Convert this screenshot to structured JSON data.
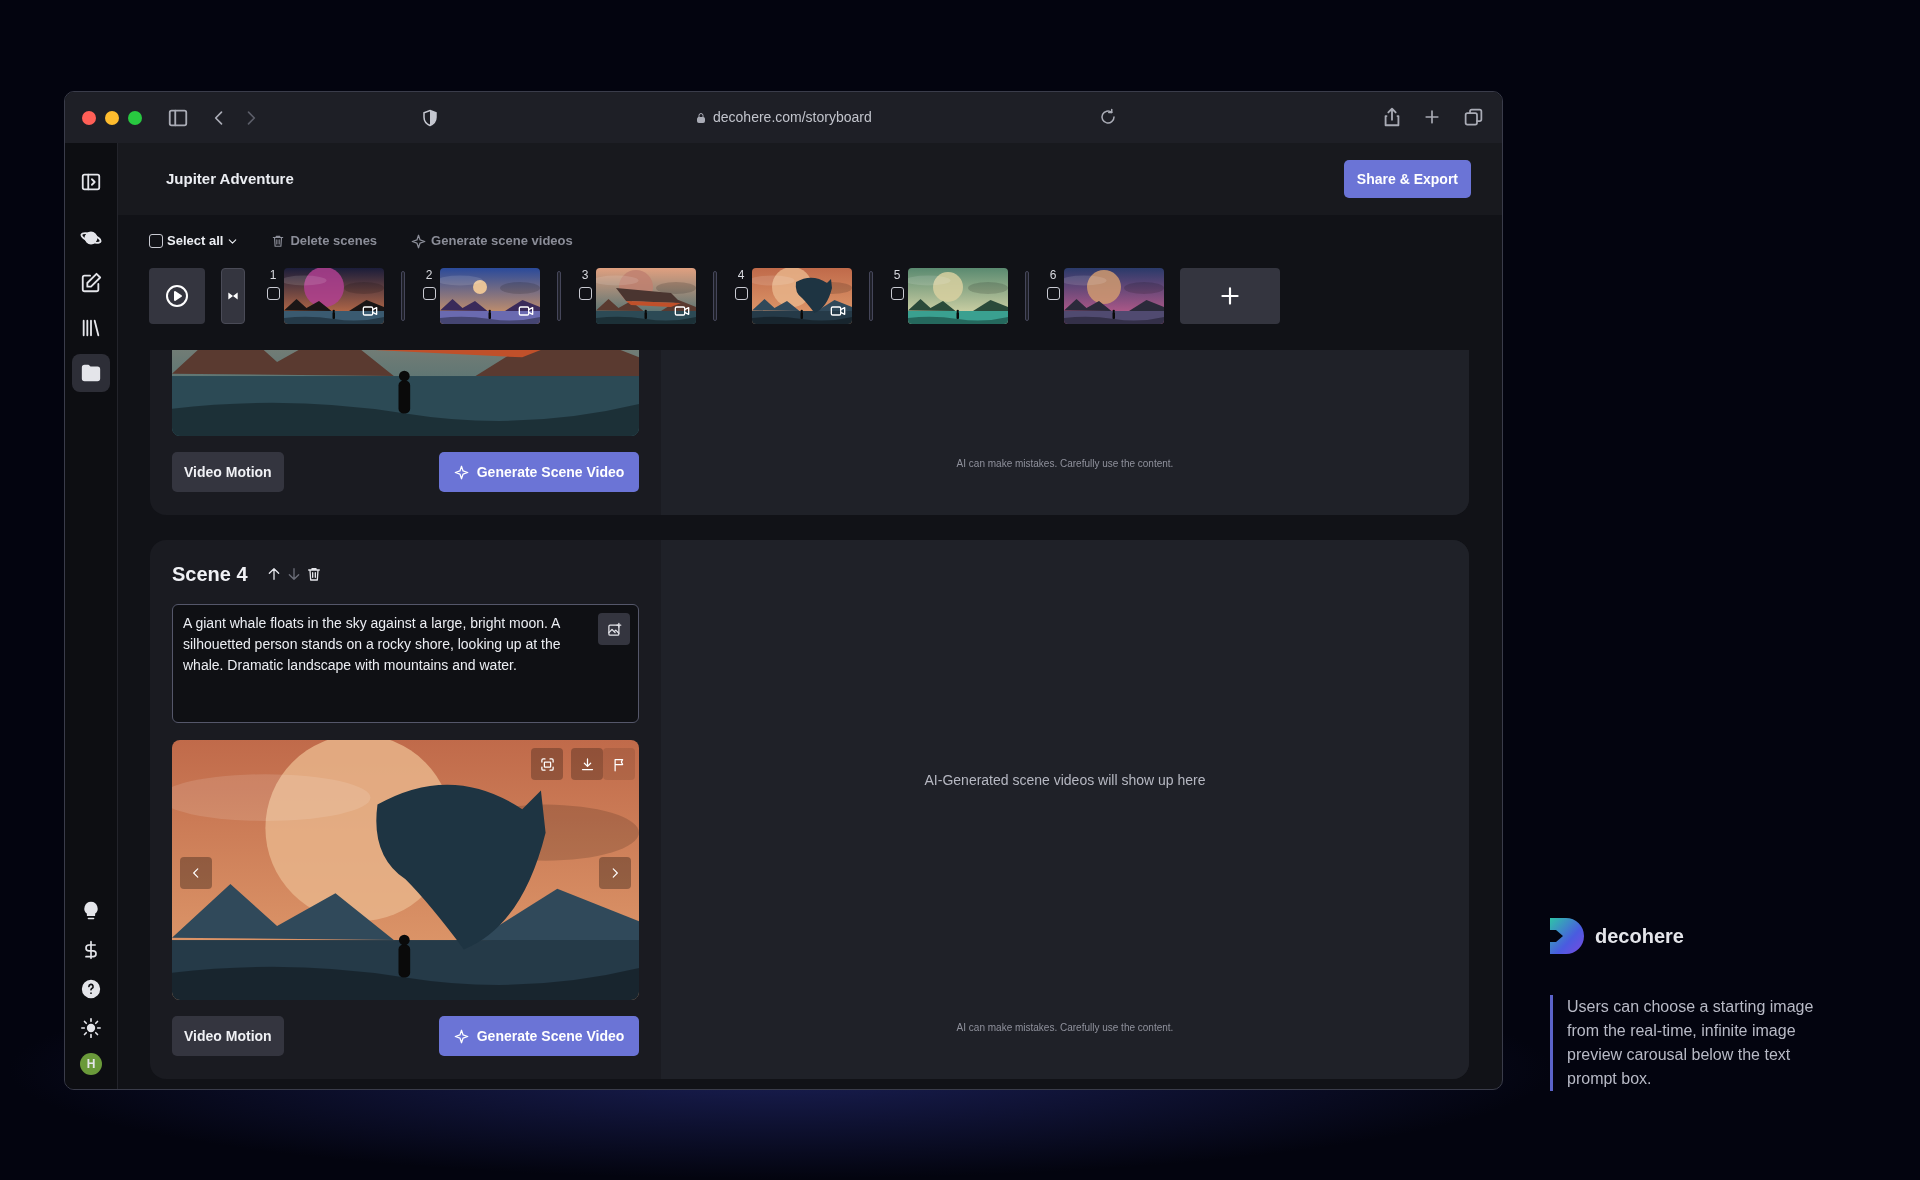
{
  "browser": {
    "url": "decohere.com/storyboard"
  },
  "sidebar": {
    "top_items": [
      {
        "selected": false
      },
      {
        "selected": false
      },
      {
        "selected": false
      },
      {
        "selected": false
      },
      {
        "selected": true
      }
    ],
    "bottom_items": [
      {
        "selected": false
      },
      {
        "selected": false
      },
      {
        "selected": false
      },
      {
        "selected": false
      }
    ],
    "avatar": "H"
  },
  "header": {
    "title": "Jupiter Adventure",
    "share_button": "Share & Export"
  },
  "toolbar": {
    "select_all": "Select all",
    "select_all_checked": false,
    "delete": "Delete scenes",
    "generate": "Generate scene videos"
  },
  "strip": [
    {
      "number": "1",
      "checked": false,
      "has_video": true
    },
    {
      "number": "2",
      "checked": false,
      "has_video": true
    },
    {
      "number": "3",
      "checked": false,
      "has_video": true
    },
    {
      "number": "4",
      "checked": false,
      "has_video": true
    },
    {
      "number": "5",
      "checked": false,
      "has_video": false
    },
    {
      "number": "6",
      "checked": false,
      "has_video": false
    }
  ],
  "scenes": [
    {
      "motion_button": "Video Motion",
      "generate_button": "Generate Scene Video",
      "note": "AI can make mistakes. Carefully use the content."
    },
    {
      "title": "Scene 4",
      "move_up_disabled": false,
      "move_down_disabled": true,
      "prompt": "A giant whale floats in the sky against a large, bright moon. A silhouetted person stands on a rocky shore, looking up at the whale. Dramatic landscape with mountains and water.",
      "video_placeholder": "AI-Generated scene videos will show up here",
      "motion_button": "Video Motion",
      "generate_button": "Generate Scene Video",
      "note": "AI can make mistakes. Carefully use the content."
    }
  ],
  "caption": {
    "brand": "decohere",
    "text": "Users can choose a starting image from the real-time, infinite image preview carousal below the text prompt box."
  }
}
